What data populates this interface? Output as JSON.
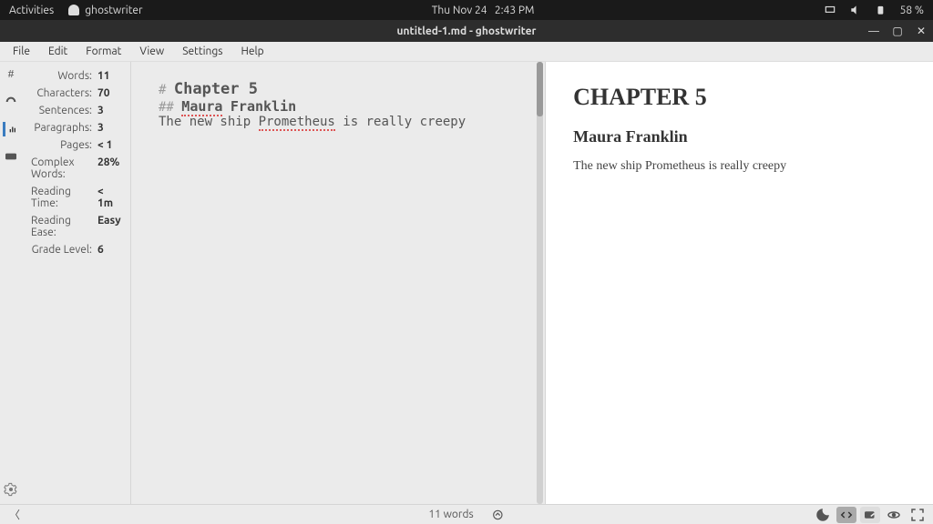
{
  "topbar": {
    "activities": "Activities",
    "app_name": "ghostwriter",
    "date": "Thu Nov 24",
    "time": "2:43 PM",
    "battery": "58 %"
  },
  "titlebar": {
    "title": "untitled-1.md - ghostwriter"
  },
  "menubar": [
    "File",
    "Edit",
    "Format",
    "View",
    "Settings",
    "Help"
  ],
  "stats": {
    "rows": [
      {
        "label": "Words:",
        "val": "11"
      },
      {
        "label": "Characters:",
        "val": "70"
      },
      {
        "label": "Sentences:",
        "val": "3"
      },
      {
        "label": "Paragraphs:",
        "val": "3"
      },
      {
        "label": "Pages:",
        "val": "< 1"
      },
      {
        "label": "Complex Words:",
        "val": "28%"
      },
      {
        "label": "Reading Time:",
        "val": "< 1m"
      },
      {
        "label": "Reading Ease:",
        "val": "Easy"
      },
      {
        "label": "Grade Level:",
        "val": "6"
      }
    ]
  },
  "editor": {
    "h1_hash": "#",
    "h1_text": "Chapter 5",
    "h2_hash": "##",
    "h2_word1": "Maura",
    "h2_word2": "Franklin",
    "body_pre": "The new ship ",
    "body_spell": "Prometheus",
    "body_post": " is really creepy"
  },
  "preview": {
    "h1": "CHAPTER 5",
    "h2": "Maura Franklin",
    "body": "The new ship Prometheus is really creepy"
  },
  "statusbar": {
    "wordcount": "11 words"
  }
}
